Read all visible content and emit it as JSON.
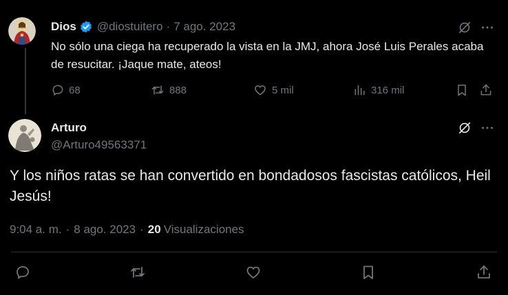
{
  "tweet1": {
    "name": "Dios",
    "handle": "@diostuitero",
    "separator": "·",
    "date": "7 ago. 2023",
    "text": "No sólo una ciega ha recuperado la vista en la JMJ, ahora José Luis Perales acaba de resucitar. ¡Jaque mate, ateos!",
    "actions": {
      "replies": "68",
      "reposts": "888",
      "likes": "5 mil",
      "views": "316 mil"
    },
    "avatar_icon": "sacred-heart-avatar",
    "verified_icon": "verified-badge-icon",
    "verified_color": "#1d9bf0"
  },
  "tweet2": {
    "name": "Arturo",
    "handle": "@Arturo49563371",
    "text": "Y los niños ratas se han convertido en bondadosos fascistas católicos, Heil Jesús!",
    "time": "9:04 a. m.",
    "separator": "·",
    "date": "8 ago. 2023",
    "views_count": "20",
    "views_label": "Visualizaciones",
    "avatar_icon": "statue-avatar"
  },
  "colors": {
    "background": "#000000",
    "text": "#e7e9ea",
    "muted": "#71767b",
    "divider": "#2f3336",
    "verified": "#1d9bf0"
  }
}
